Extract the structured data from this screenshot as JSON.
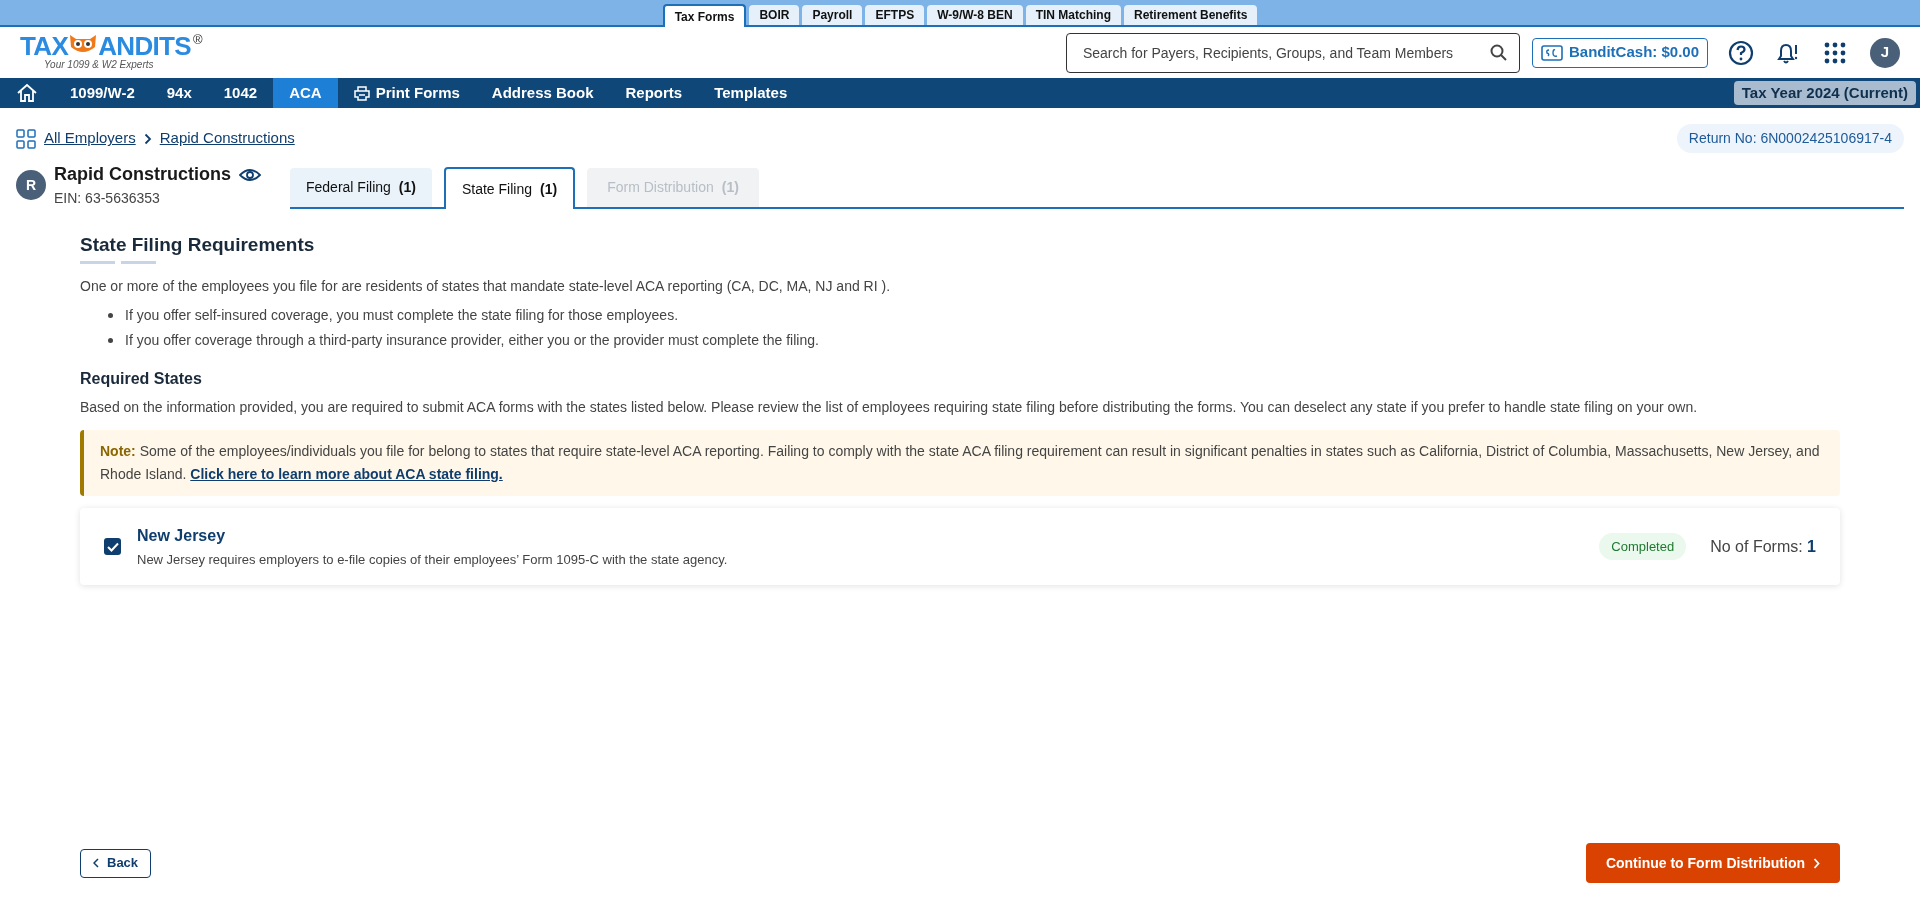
{
  "product_tabs": [
    {
      "label": "Tax Forms",
      "selected": true
    },
    {
      "label": "BOIR",
      "selected": false
    },
    {
      "label": "Payroll",
      "selected": false
    },
    {
      "label": "EFTPS",
      "selected": false
    },
    {
      "label": "W-9/W-8 BEN",
      "selected": false
    },
    {
      "label": "TIN Matching",
      "selected": false
    },
    {
      "label": "Retirement Benefits",
      "selected": false
    }
  ],
  "logo": {
    "left": "TAX",
    "right": "ANDITS",
    "mark": "®",
    "tagline": "Your 1099 & W2 Experts"
  },
  "search": {
    "placeholder": "Search for Payers, Recipients, Groups, and Team Members"
  },
  "bandit_cash": "BanditCash: $0.00",
  "avatar": "J",
  "nav": [
    {
      "label": "1099/W-2",
      "kind": "text",
      "selected": false
    },
    {
      "label": "94x",
      "kind": "text",
      "selected": false
    },
    {
      "label": "1042",
      "kind": "text",
      "selected": false
    },
    {
      "label": "ACA",
      "kind": "text",
      "selected": true
    },
    {
      "label": "Print Forms",
      "kind": "print",
      "selected": false
    },
    {
      "label": "Address Book",
      "kind": "text",
      "selected": false
    },
    {
      "label": "Reports",
      "kind": "text",
      "selected": false
    },
    {
      "label": "Templates",
      "kind": "text",
      "selected": false
    }
  ],
  "tax_year": "Tax Year 2024 (Current)",
  "breadcrumb": [
    "All Employers",
    "Rapid Constructions"
  ],
  "return_no": "Return No: 6N0002425106917-4",
  "employer": {
    "initial": "R",
    "name": "Rapid Constructions",
    "ein": "EIN: 63-5636353"
  },
  "filing_tabs": [
    {
      "label": "Federal Filing",
      "count": "(1)",
      "selected": false,
      "disabled": false
    },
    {
      "label": "State Filing",
      "count": "(1)",
      "selected": true,
      "disabled": false
    },
    {
      "label": "Form Distribution",
      "count": "(1)",
      "selected": false,
      "disabled": true
    }
  ],
  "heading": "State Filing Requirements",
  "intro": "One or more of the employees you file for are residents of states that mandate state-level ACA reporting (CA, DC, MA, NJ and RI ).",
  "bullets": [
    "If you offer self-insured coverage, you must complete the state filing for those employees.",
    "If you offer coverage through a third-party insurance provider, either you or the provider must complete the filing."
  ],
  "required_heading": "Required States",
  "required_text": "Based on the information provided, you are required to submit ACA forms with the states listed below. Please review the list of employees requiring state filing before distributing the forms. You can deselect any state if you prefer to handle state filing on your own.",
  "note": {
    "label": "Note:",
    "text": "Some of the employees/individuals you file for belong to states that require state-level ACA reporting. Failing to comply with the state ACA filing requirement can result in significant penalties in states such as California, District of Columbia, Massachusetts, New Jersey, and Rhode Island.",
    "link": "Click here to learn more about ACA state filing."
  },
  "states": [
    {
      "name": "New Jersey",
      "description": "New Jersey requires employers to e-file copies of their employees’ Form 1095-C with the state agency.",
      "checked": true,
      "status": "Completed",
      "forms_label": "No of Forms:",
      "forms_count": "1"
    }
  ],
  "back_button": "Back",
  "continue_button": "Continue to Form Distribution"
}
